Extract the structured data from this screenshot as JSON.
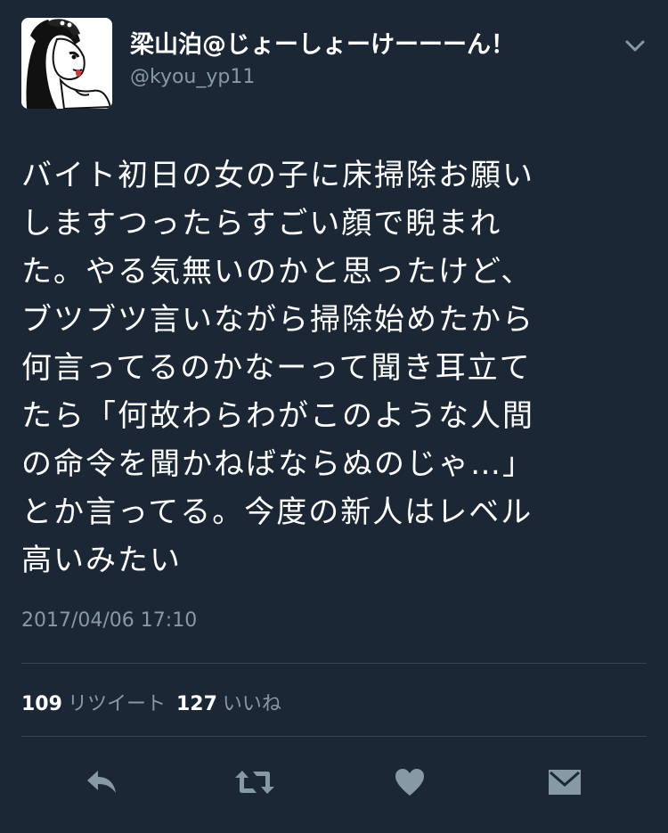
{
  "user": {
    "display_name": "梁山泊@じょーしょーけーーーん！",
    "handle": "@kyou_yp11"
  },
  "tweet": {
    "lines": [
      "バイト初日の女の子に床掃除お願い",
      "しますつったらすごい顔で睨まれ",
      "た。やる気無いのかと思ったけど、",
      "ブツブツ言いながら掃除始めたから",
      "何言ってるのかなーって聞き耳立て",
      "たら「何故わらわがこのような人間",
      "の命令を聞かねばならぬのじゃ…」",
      "とか言ってる。今度の新人はレベル",
      "高いみたい"
    ],
    "timestamp": "2017/04/06 17:10"
  },
  "stats": {
    "retweets_count": "109",
    "retweets_label": "リツイート",
    "likes_count": "127",
    "likes_label": "いいね"
  },
  "actions": {
    "icons": [
      "reply-icon",
      "retweet-icon",
      "like-icon",
      "direct-message-icon"
    ]
  },
  "colors": {
    "background": "#1b2735",
    "text": "#ffffff",
    "secondary_text": "#8899a6",
    "divider": "#38444d"
  }
}
